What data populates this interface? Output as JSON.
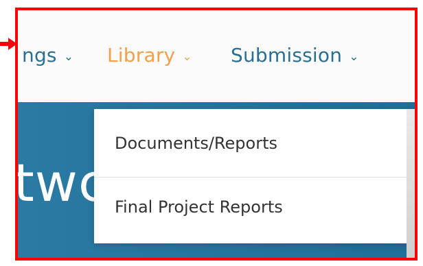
{
  "nav": {
    "items": [
      {
        "label": "ngs",
        "state": "default"
      },
      {
        "label": "Library",
        "state": "active"
      },
      {
        "label": "Submission",
        "state": "default"
      }
    ],
    "chevron_icon": "chevron-down-icon"
  },
  "hero": {
    "text": "twc"
  },
  "dropdown": {
    "items": [
      {
        "label": "Documents/Reports"
      },
      {
        "label": "Final Project Reports"
      }
    ]
  },
  "colors": {
    "highlight_border": "#ff0000",
    "nav_text": "#2a6f91",
    "nav_active": "#f0a14a",
    "hero_bg": "#2a79a2",
    "dropdown_text": "#333333"
  }
}
